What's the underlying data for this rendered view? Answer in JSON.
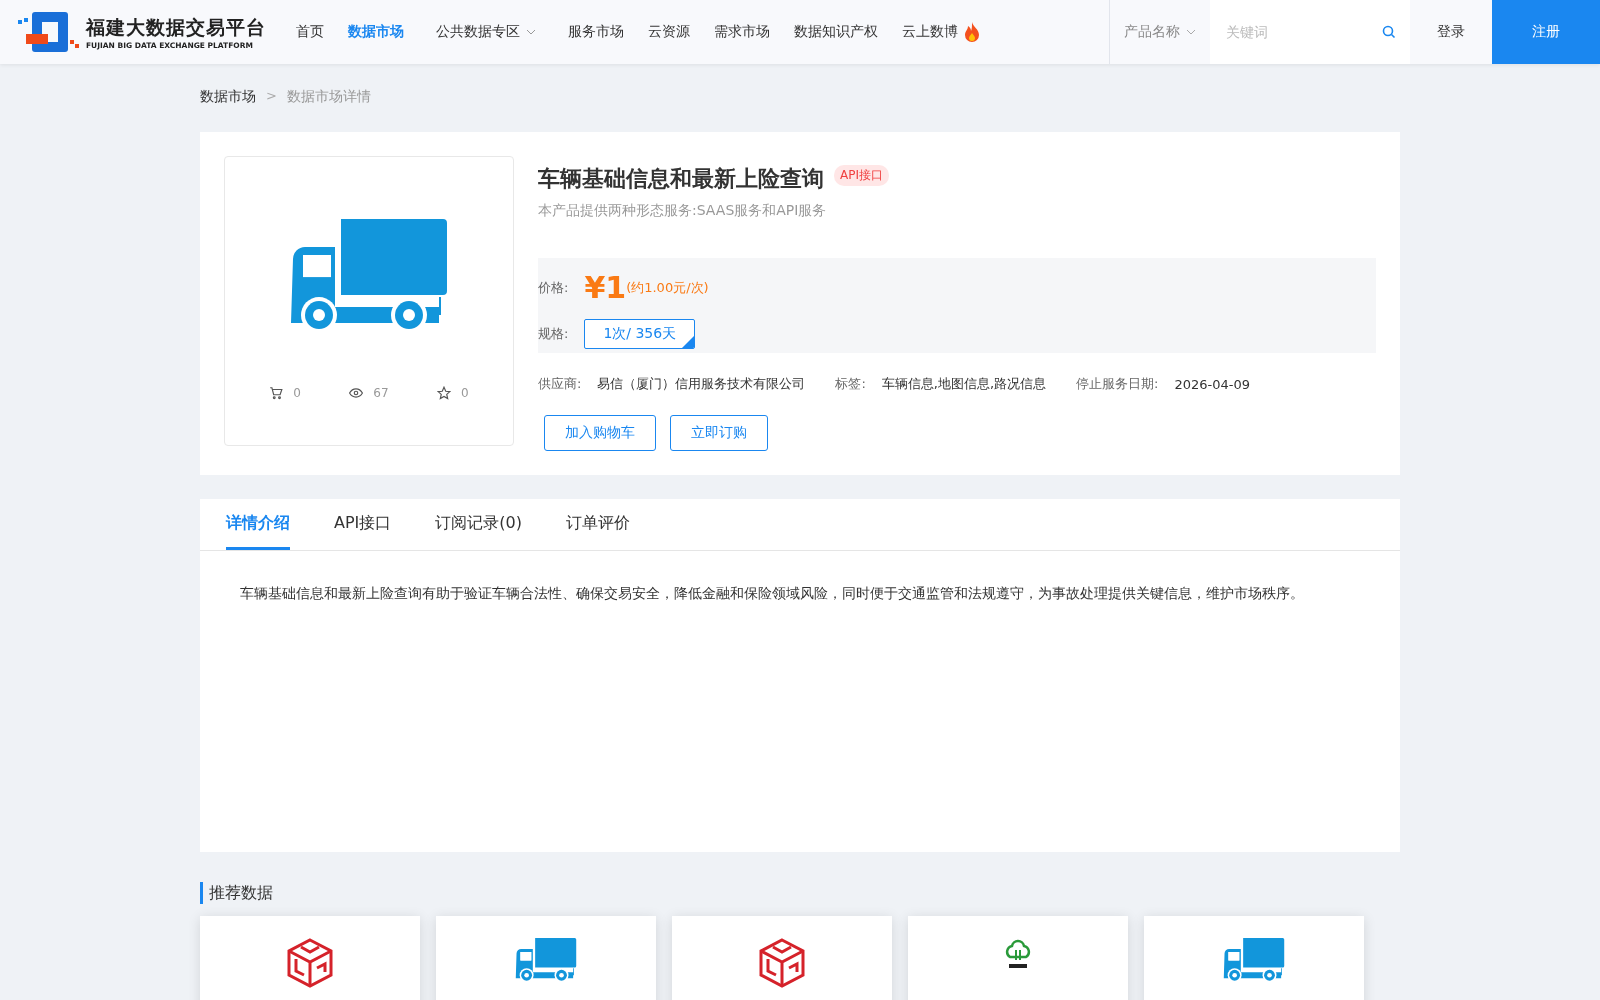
{
  "header": {
    "logo_title": "福建大数据交易平台",
    "logo_subtitle": "FUJIAN BIG DATA EXCHANGE  PLATFORM",
    "nav": [
      {
        "label": "首页",
        "selected": false
      },
      {
        "label": "数据市场",
        "selected": true
      },
      {
        "label": "公共数据专区",
        "selected": false,
        "dropdown": true
      },
      {
        "label": "服务市场",
        "selected": false
      },
      {
        "label": "云资源",
        "selected": false
      },
      {
        "label": "需求市场",
        "selected": false
      },
      {
        "label": "数据知识产权",
        "selected": false
      },
      {
        "label": "云上数博",
        "selected": false,
        "hot": true
      }
    ],
    "search_category": "产品名称",
    "search": {
      "placeholder": "关键词"
    },
    "login": "登录",
    "register": "注册"
  },
  "breadcrumb": [
    {
      "label": "数据市场"
    },
    {
      "label": "数据市场详情"
    }
  ],
  "breadcrumb_separator": ">",
  "product": {
    "title": "车辆基础信息和最新上险查询",
    "badge": "API接口",
    "subtitle": "本产品提供两种形态服务:SAAS服务和API服务",
    "stats": [
      {
        "kind": "cart",
        "value": "0"
      },
      {
        "kind": "views",
        "value": "67"
      },
      {
        "kind": "star",
        "value": "0"
      }
    ],
    "price_label": "价格:",
    "price": "¥1",
    "price_note": "(约1.00元/次)",
    "spec_label": "规格:",
    "specs": [
      {
        "label": "1次/ 356天",
        "selected": true
      }
    ],
    "info": [
      {
        "label": "供应商:",
        "value": "易信（厦门）信用服务技术有限公司"
      },
      {
        "label": "标签:",
        "value": "车辆信息,地图信息,路况信息"
      },
      {
        "label": "停止服务日期:",
        "value": "2026-04-09"
      }
    ],
    "buttons": [
      "加入购物车",
      "立即订购"
    ]
  },
  "tabs": [
    {
      "label": "详情介绍",
      "selected": true
    },
    {
      "label": "API接口",
      "selected": false
    },
    {
      "label": "订阅记录(0)",
      "selected": false
    },
    {
      "label": "订单评价",
      "selected": false
    }
  ],
  "description": "车辆基础信息和最新上险查询有助于验证车辆合法性、确保交易安全，降低金融和保险领域风险，同时便于交通监管和法规遵守，为事故处理提供关键信息，维护市场秩序。",
  "recommended": {
    "title": "推荐数据",
    "cards": [
      {
        "kind": "cube"
      },
      {
        "kind": "truck"
      },
      {
        "kind": "cube"
      },
      {
        "kind": "tree"
      },
      {
        "kind": "truck"
      }
    ]
  }
}
